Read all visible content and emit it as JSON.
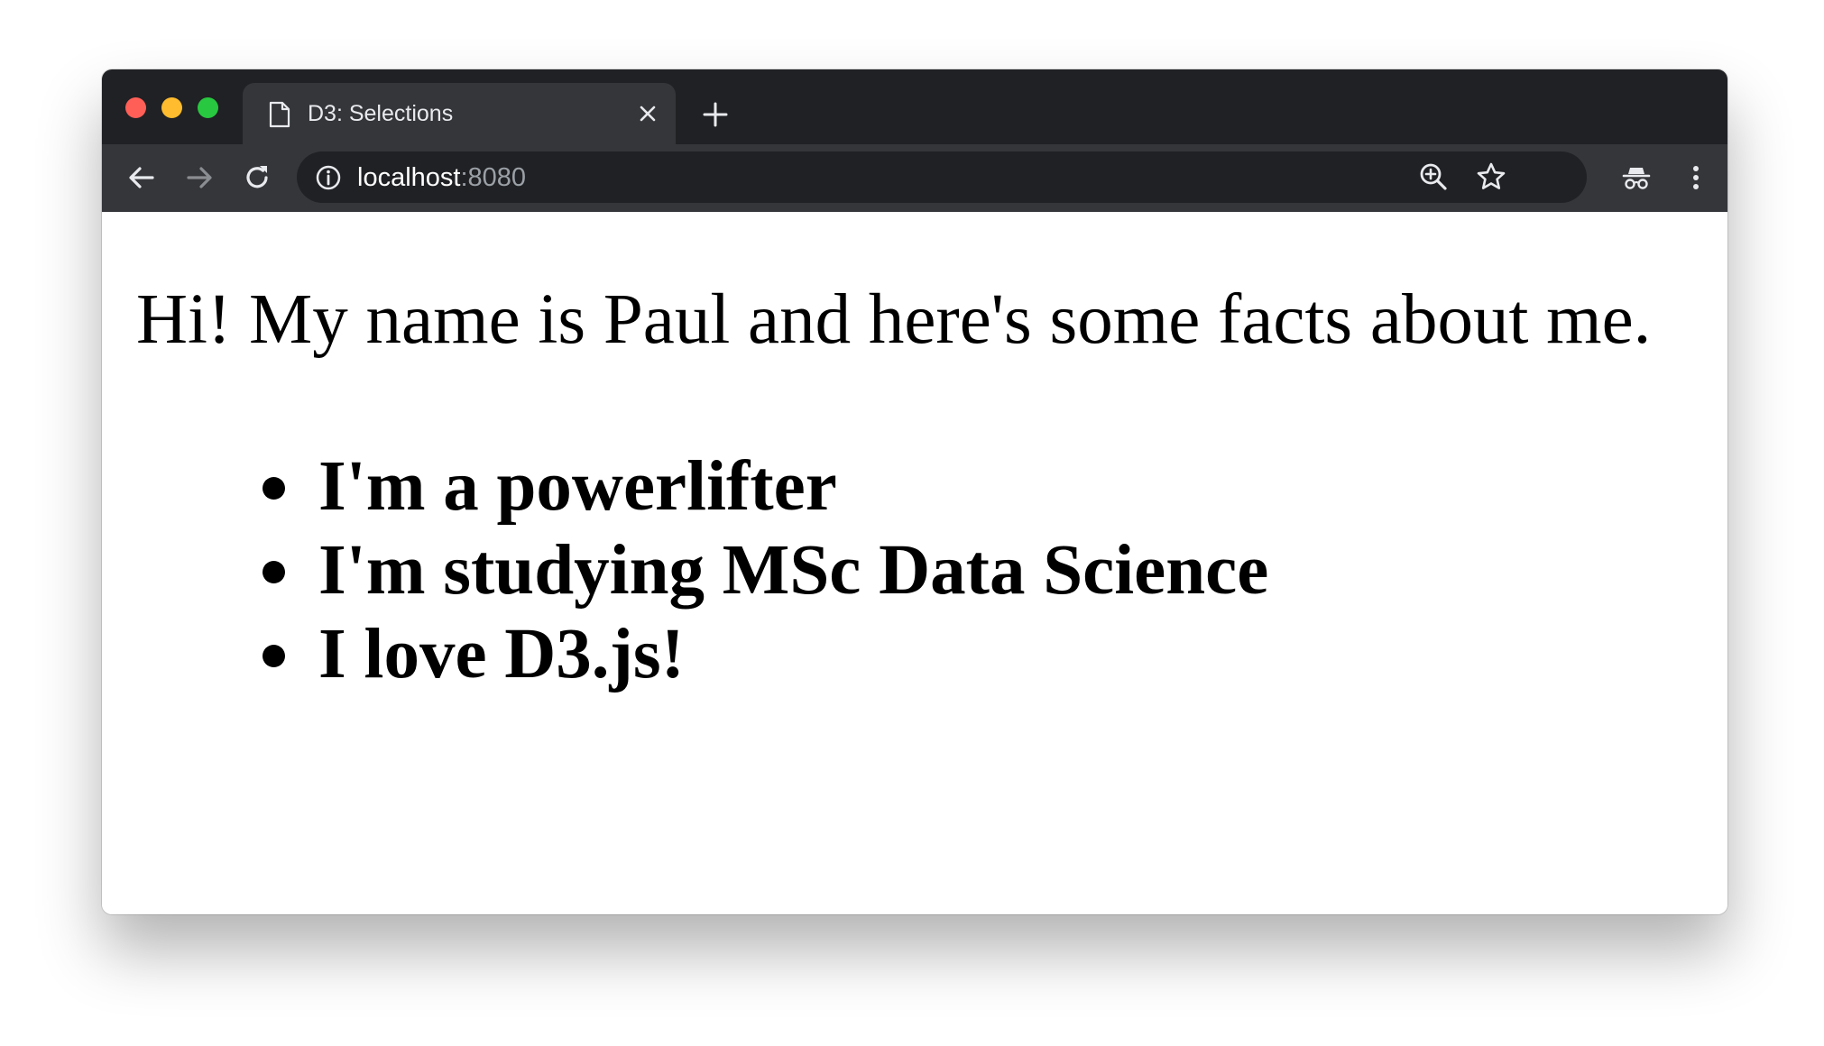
{
  "window": {
    "controls": {
      "close_color": "#ff5f57",
      "minimize_color": "#febc2e",
      "zoom_color": "#28c840"
    }
  },
  "tabs": [
    {
      "title": "D3: Selections",
      "icon": "document-icon",
      "active": true
    }
  ],
  "address_bar": {
    "host": "localhost",
    "port": ":8080",
    "leading_icon": "info-icon"
  },
  "toolbar_icons": [
    "back-arrow-icon",
    "forward-arrow-icon",
    "reload-icon",
    "zoom-icon",
    "bookmark-star-icon",
    "incognito-icon",
    "menu-dots-icon"
  ],
  "page": {
    "intro": "Hi! My name is Paul and here's some facts about me.",
    "facts": [
      "I'm a powerlifter",
      "I'm studying MSc Data Science",
      "I love D3.js!"
    ]
  },
  "colors": {
    "tabbar_bg": "#202124",
    "toolbar_bg": "#35363a",
    "omnibox_bg": "#202124",
    "icon_color": "#e8eaed"
  }
}
